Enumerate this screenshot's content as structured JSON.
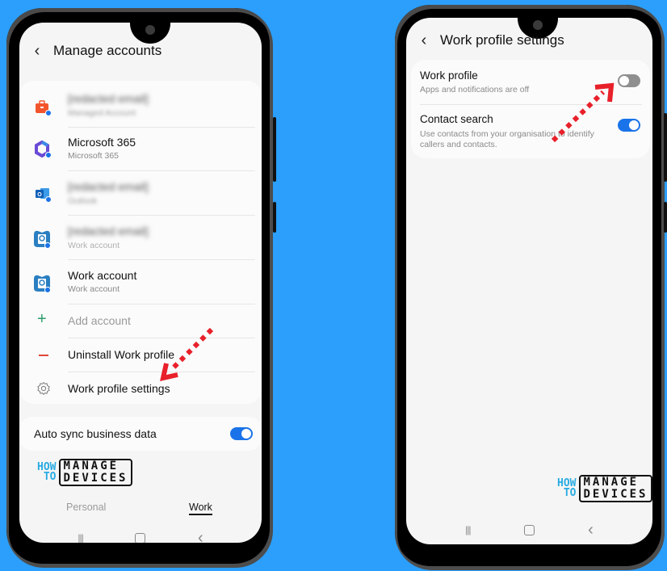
{
  "left_phone": {
    "header": {
      "back_icon": "chevron-left-icon",
      "title": "Manage accounts"
    },
    "accounts": [
      {
        "icon": "briefcase-icon",
        "name": "[redacted email]",
        "type": "Managed Account",
        "redacted": true,
        "icon_color": "#f2552c"
      },
      {
        "icon": "microsoft-365-icon",
        "name": "Microsoft 365",
        "type": "Microsoft 365",
        "redacted": false,
        "icon_color": "#6a4bd6"
      },
      {
        "icon": "outlook-icon",
        "name": "[redacted email]",
        "type": "Outlook",
        "redacted": true,
        "icon_color": "#1a73c8"
      },
      {
        "icon": "work-account-icon",
        "name": "[redacted email]",
        "type": "Work account",
        "redacted": true,
        "icon_color": "#2a7fc1"
      },
      {
        "icon": "work-account-icon",
        "name": "Work account",
        "type": "Work account",
        "redacted": false,
        "icon_color": "#2a7fc1"
      }
    ],
    "actions": [
      {
        "icon": "plus-icon",
        "label": "Add account",
        "disabled": true,
        "icon_color": "#2e9d6b"
      },
      {
        "icon": "minus-icon",
        "label": "Uninstall Work profile",
        "disabled": false,
        "icon_color": "#e0453a"
      },
      {
        "icon": "gear-icon",
        "label": "Work profile settings",
        "disabled": false,
        "icon_color": "#777777"
      }
    ],
    "auto_sync": {
      "label": "Auto sync business data",
      "enabled": true
    },
    "logo": {
      "how": "HOW",
      "to": "TO",
      "manage": "MANAGE",
      "devices": "DEVICES"
    },
    "tabs": [
      {
        "label": "Personal",
        "active": false
      },
      {
        "label": "Work",
        "active": true
      }
    ],
    "nav": {
      "recents": "|||",
      "home": "▢",
      "back": "‹"
    }
  },
  "right_phone": {
    "header": {
      "back_icon": "chevron-left-icon",
      "title": "Work profile settings"
    },
    "settings": [
      {
        "title": "Work profile",
        "subtitle": "Apps and notifications are off",
        "enabled": false
      },
      {
        "title": "Contact search",
        "subtitle_line1": "Use contacts from your organisation to identify",
        "subtitle_line2": "callers and contacts.",
        "enabled": true
      }
    ],
    "logo": {
      "how": "HOW",
      "to": "TO",
      "manage": "MANAGE",
      "devices": "DEVICES"
    },
    "nav": {
      "recents": "|||",
      "home": "▢",
      "back": "‹"
    }
  },
  "colors": {
    "background": "#2b9ffb",
    "accent": "#1a73e8",
    "annotation_arrow": "#e8202a",
    "logo_blue": "#29abe2"
  }
}
